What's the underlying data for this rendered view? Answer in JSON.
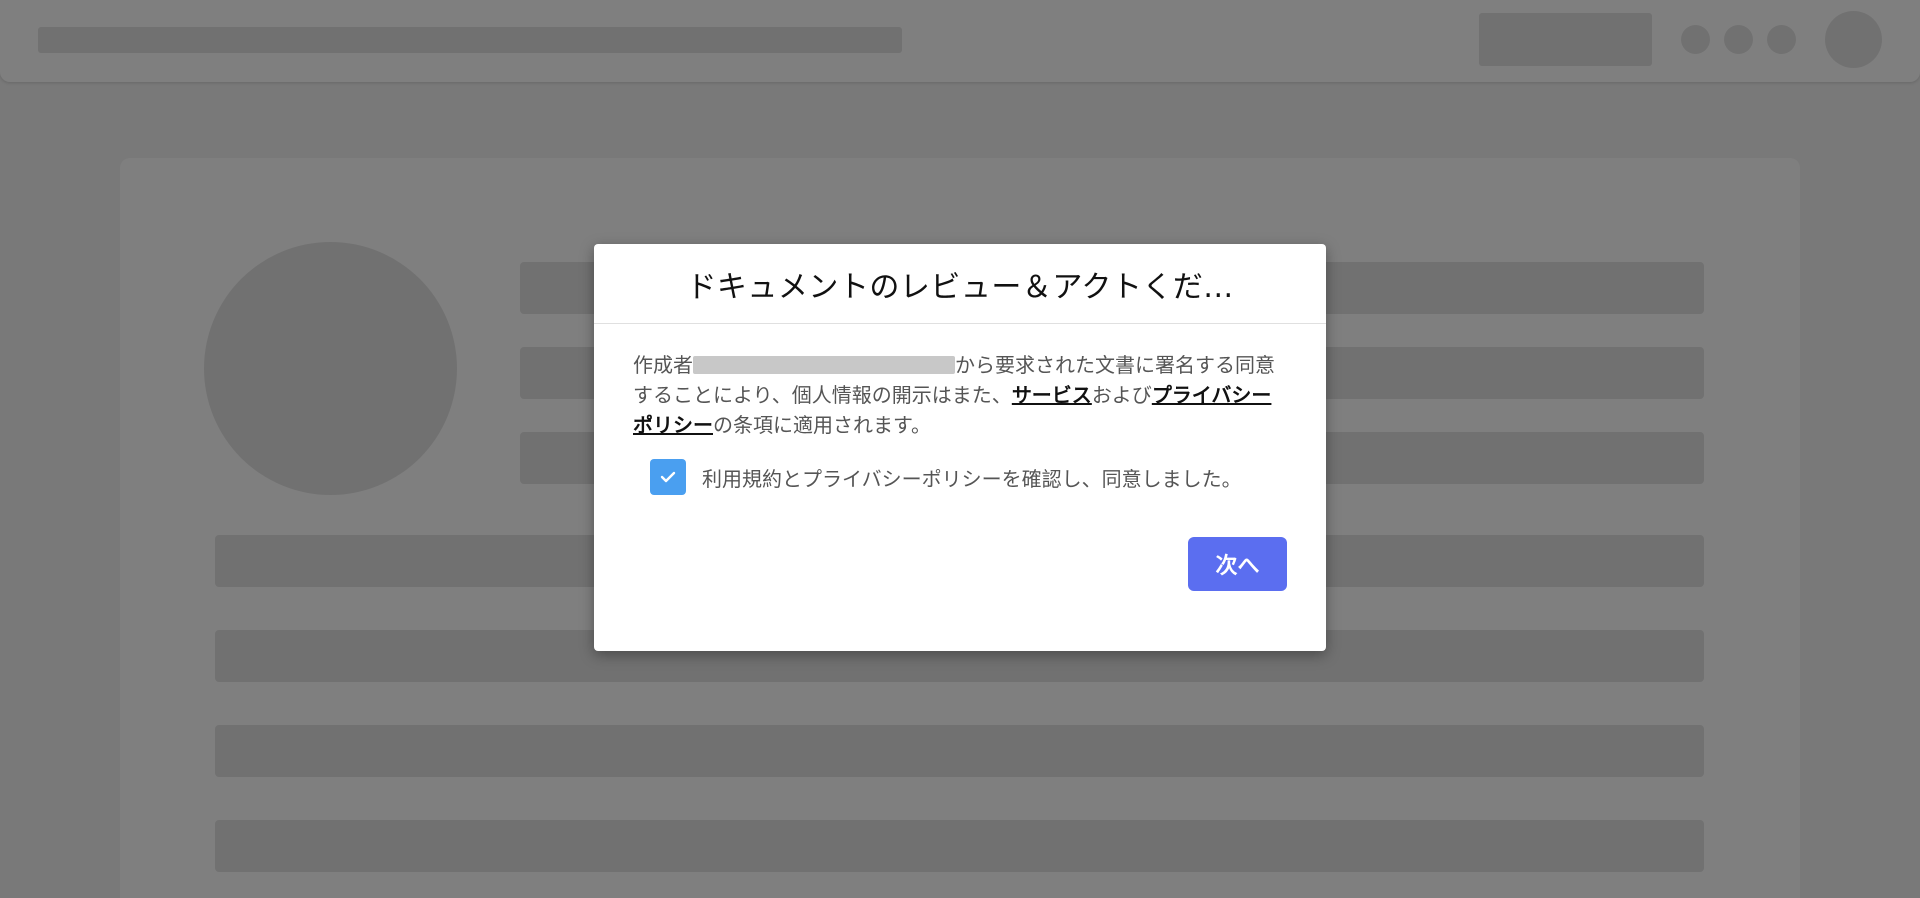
{
  "modal": {
    "title": "ドキュメントのレビュー＆アクトくだ...",
    "consent_prefix": "作成者",
    "consent_middle": "から要求された文書に署名する同意することにより、個人情報の開示はまた、",
    "service_link": "サービス",
    "conjunction": "および",
    "privacy_link": "プライバシーポリシー",
    "consent_suffix": "の条項に適用されます。",
    "checkbox_label": "利用規約とプライバシーポリシーを確認し、同意しました。",
    "checkbox_checked": true,
    "next_button_label": "次へ"
  },
  "colors": {
    "accent": "#5b6ef0",
    "checkbox": "#4a9ff0",
    "overlay": "rgba(0,0,0,0.5)"
  },
  "icons": {
    "checkbox": "check-icon"
  }
}
